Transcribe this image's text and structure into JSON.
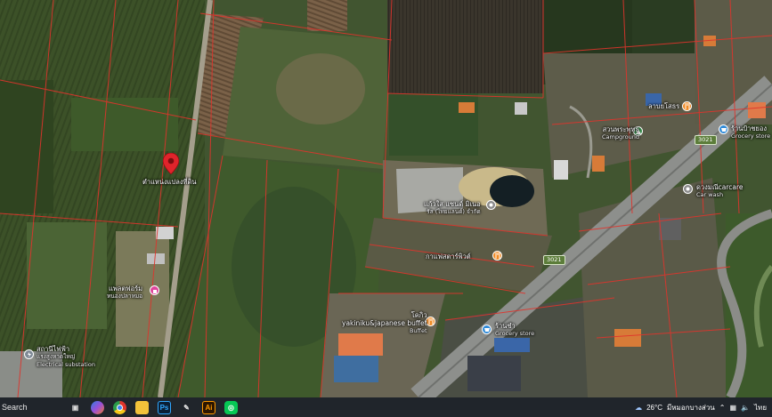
{
  "map": {
    "pin": {
      "label": "ตำแหน่งแปลงที่ดิน",
      "color": "#e0242b"
    },
    "pois": [
      {
        "id": "factory",
        "line1": "แก้วใส แซนด์ มิเนอ",
        "line2": "รัล (ไทยแลนด์) จำกัด",
        "icon": "pin-gray-icon"
      },
      {
        "id": "restaurant-mid",
        "line1": "กาแฟสตาร์พิวต์",
        "line2": "",
        "icon": "restaurant-icon"
      },
      {
        "id": "market",
        "line1": "แพลตฟอร์ม",
        "line2": "หนองปลาหมอ",
        "icon": "shopping-icon"
      },
      {
        "id": "substation",
        "line1": "สถานีไฟฟ้า",
        "line2": "แรงสูงหาดใหญ่",
        "line3": "Electrical substation",
        "icon": "substation-icon"
      },
      {
        "id": "yakiniku",
        "line1": "โคกิว",
        "line2": "yakiniku&japanese buffet",
        "line3": "Buffet",
        "icon": "restaurant-icon"
      },
      {
        "id": "grocery-bottom",
        "line1": "ร้านชำ",
        "line2": "Grocery store",
        "icon": "grocery-icon"
      },
      {
        "id": "carcare",
        "line1": "ดวงมณีcarcare",
        "line2": "Car wash",
        "icon": "carwash-icon"
      },
      {
        "id": "grocery-right",
        "line1": "ร้านป้าชยอง",
        "line2": "Grocery store",
        "icon": "grocery-icon"
      },
      {
        "id": "campground",
        "line1": "สวนพระพุทธ",
        "line2": "Campground",
        "icon": "campground-icon"
      },
      {
        "id": "restaurant-top",
        "line1": "ลาบยโสธร",
        "line2": "",
        "icon": "restaurant-icon"
      }
    ],
    "road_shields": [
      "3021",
      "3021"
    ]
  },
  "taskbar": {
    "search_label": "Search",
    "apps": [
      {
        "name": "task-view-icon",
        "glyph": "▣"
      },
      {
        "name": "copilot-icon",
        "glyph": "●"
      },
      {
        "name": "chrome-icon",
        "glyph": "◉"
      },
      {
        "name": "file-explorer-icon",
        "glyph": "▰"
      },
      {
        "name": "photoshop-icon",
        "glyph": "Ps"
      },
      {
        "name": "pen-tool-icon",
        "glyph": "✎"
      },
      {
        "name": "illustrator-icon",
        "glyph": "Ai"
      },
      {
        "name": "line-icon",
        "glyph": "◎"
      }
    ],
    "weather": "26°C",
    "weather_desc": "มีหมอกบางส่วน",
    "language": "ไทย"
  }
}
